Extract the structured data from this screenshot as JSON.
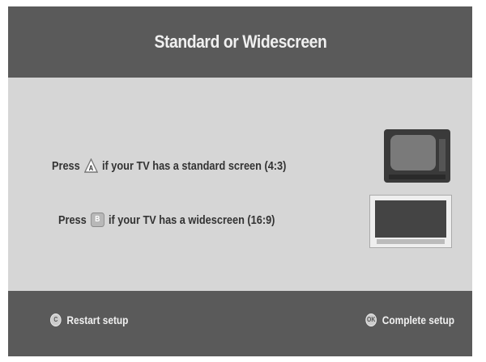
{
  "header": {
    "title": "Standard or Widescreen"
  },
  "options": [
    {
      "prefix": "Press",
      "key": "A",
      "text": "if your TV has a standard screen (4:3)"
    },
    {
      "prefix": "Press",
      "key": "B",
      "text": "if your TV has a widescreen (16:9)"
    }
  ],
  "footer": {
    "left_key": "C",
    "left_label": "Restart setup",
    "right_key": "OK",
    "right_label": "Complete setup"
  },
  "colors": {
    "header_bg": "#5a5a5a",
    "content_bg": "#d6d6d6",
    "footer_bg": "#5a5a5a",
    "text_light": "#f0f0f0",
    "text_dark": "#333333"
  },
  "icons": {
    "key_a": "triangle-a-key-icon",
    "key_b": "square-b-key-icon",
    "standard_tv": "crt-tv-icon",
    "widescreen_tv": "widescreen-tv-icon",
    "restart": "round-c-key-icon",
    "complete": "round-ok-key-icon"
  }
}
